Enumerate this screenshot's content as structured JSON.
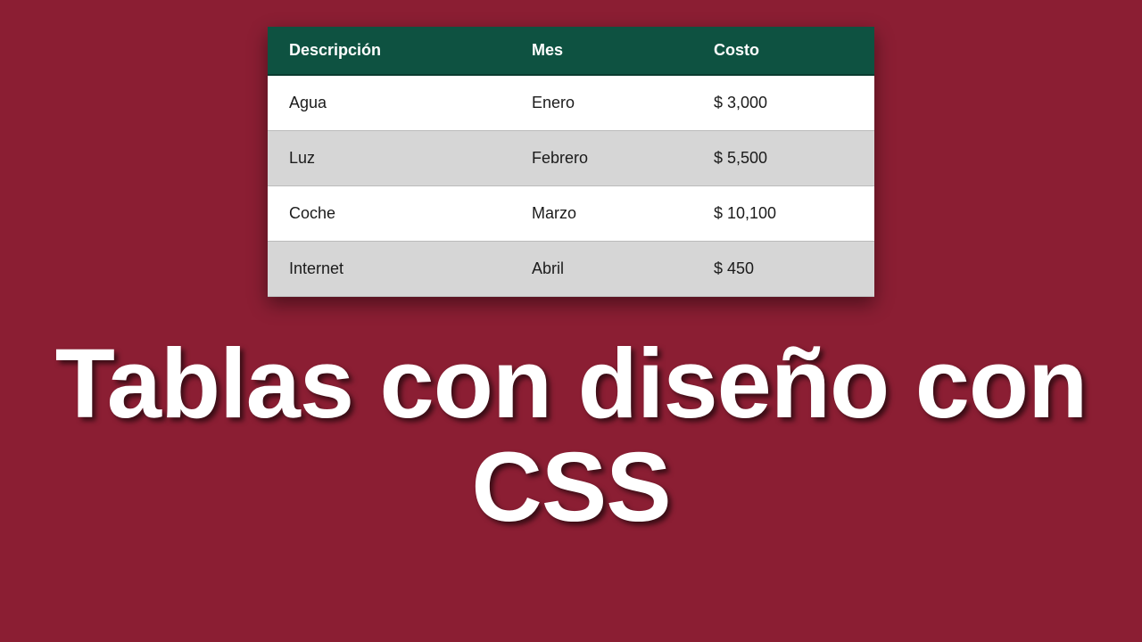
{
  "table": {
    "headers": {
      "description": "Descripción",
      "month": "Mes",
      "cost": "Costo"
    },
    "rows": [
      {
        "description": "Agua",
        "month": "Enero",
        "cost": "$ 3,000"
      },
      {
        "description": "Luz",
        "month": "Febrero",
        "cost": "$ 5,500"
      },
      {
        "description": "Coche",
        "month": "Marzo",
        "cost": "$ 10,100"
      },
      {
        "description": "Internet",
        "month": "Abril",
        "cost": "$ 450"
      }
    ]
  },
  "title": "Tablas con diseño con CSS"
}
